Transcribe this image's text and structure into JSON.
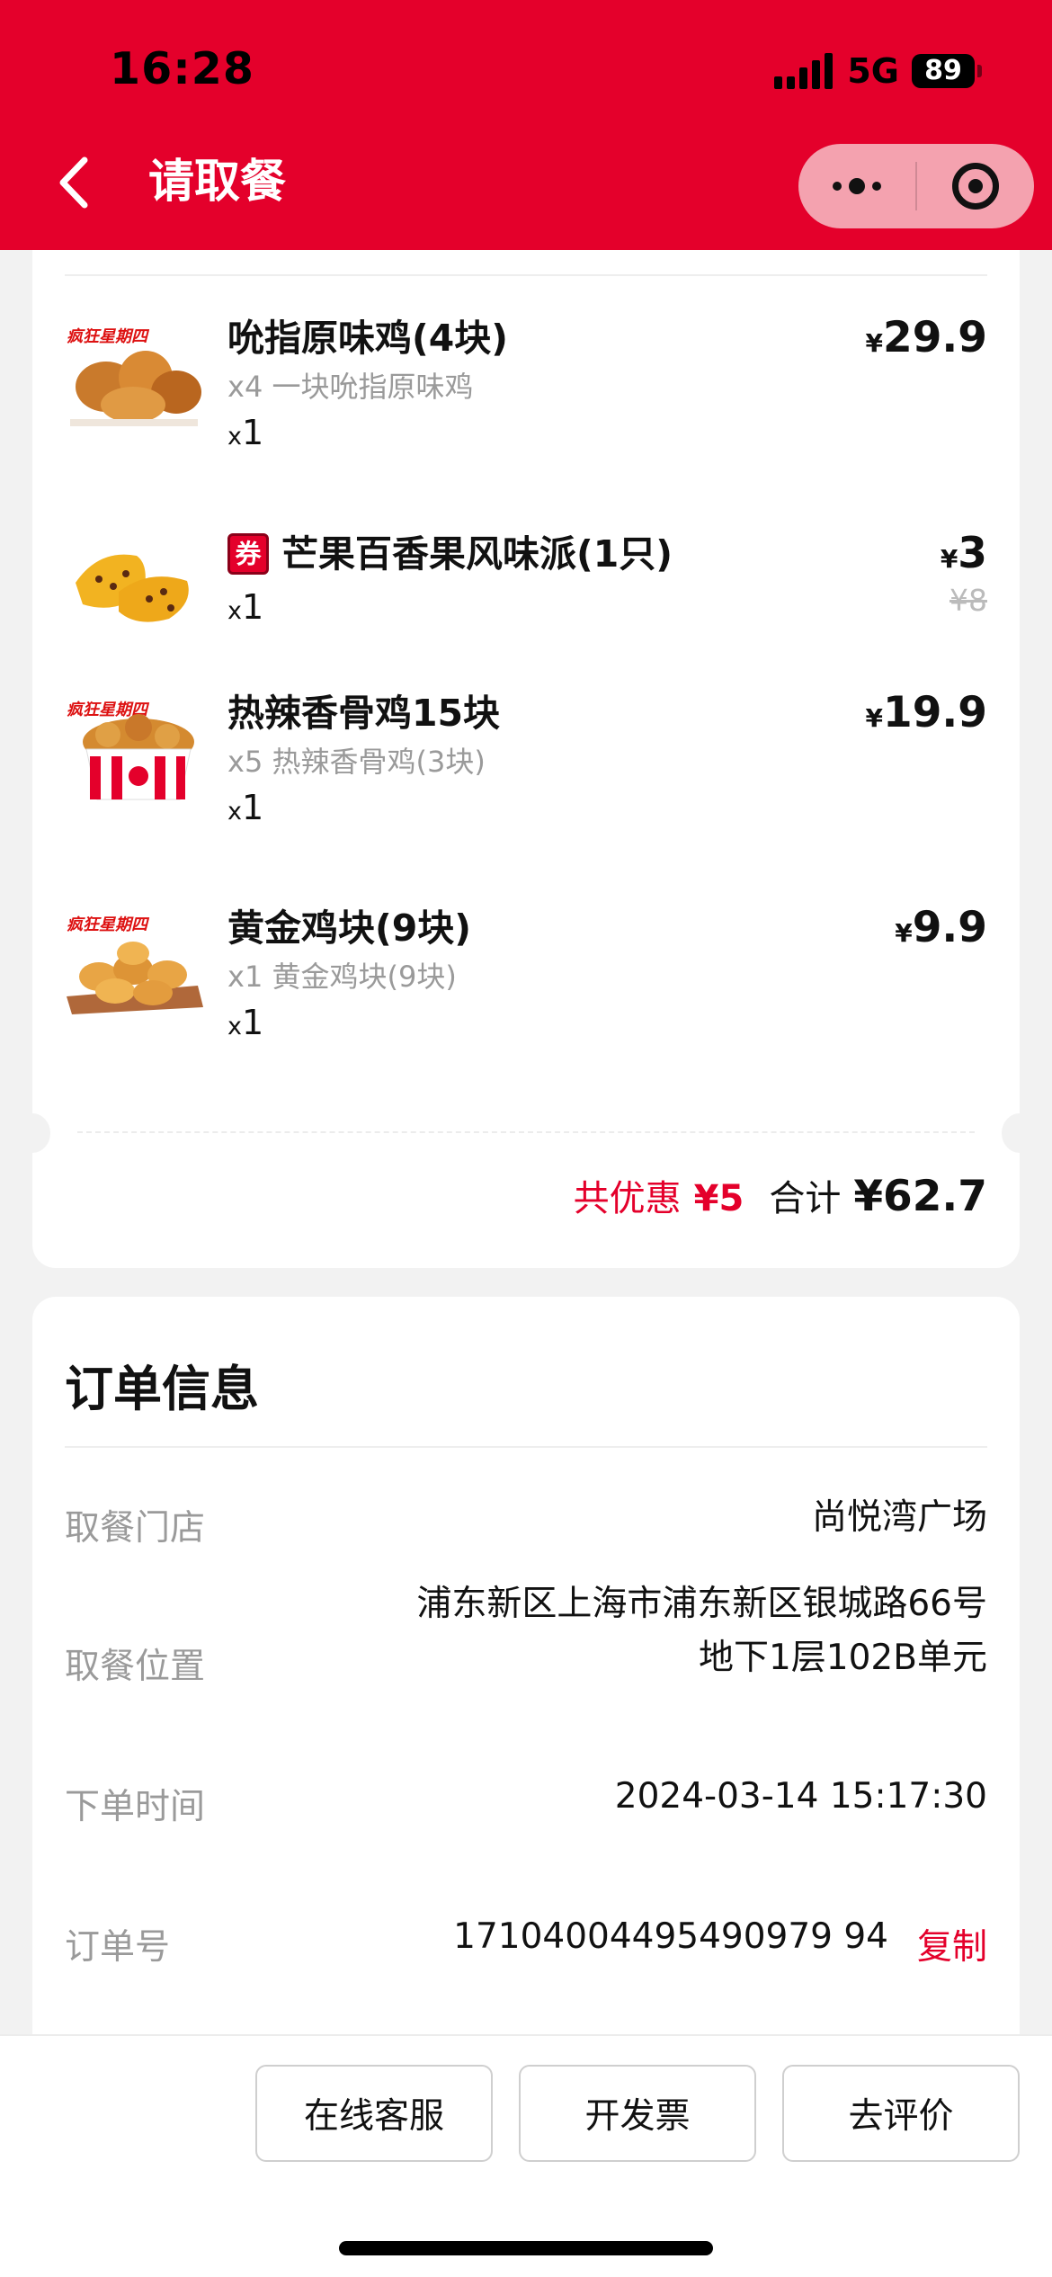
{
  "status_bar": {
    "time": "16:28",
    "network": "5G",
    "battery": "89"
  },
  "header": {
    "title": "请取餐",
    "background_color": "#e4002b"
  },
  "items": [
    {
      "name": "吮指原味鸡(4块)",
      "sub": "x4 一块吮指原味鸡",
      "qty_x": "x",
      "qty_n": "1",
      "currency": "¥",
      "price": "29.9",
      "thumb_icon": "fried-chicken-icon",
      "coupon": false
    },
    {
      "name": "芒果百香果风味派(1只)",
      "qty_x": "x",
      "qty_n": "1",
      "currency": "¥",
      "price": "3",
      "original_price": "¥8",
      "coupon": true,
      "coupon_label": "券",
      "thumb_icon": "mango-pie-icon"
    },
    {
      "name": "热辣香骨鸡15块",
      "sub": "x5 热辣香骨鸡(3块)",
      "qty_x": "x",
      "qty_n": "1",
      "currency": "¥",
      "price": "19.9",
      "thumb_icon": "chicken-bucket-icon",
      "coupon": false
    },
    {
      "name": "黄金鸡块(9块)",
      "sub": "x1 黄金鸡块(9块)",
      "qty_x": "x",
      "qty_n": "1",
      "currency": "¥",
      "price": "9.9",
      "thumb_icon": "chicken-nuggets-icon",
      "coupon": false
    }
  ],
  "totals": {
    "discount_label": "共优惠",
    "discount_value": "¥5",
    "total_label": "合计",
    "total_value": "¥62.7"
  },
  "order_info": {
    "title": "订单信息",
    "store_label": "取餐门店",
    "store_value": "尚悦湾广场",
    "location_label": "取餐位置",
    "location_line1": "浦东新区上海市浦东新区银城路66号",
    "location_line2": "地下1层102B单元",
    "time_label": "下单时间",
    "time_value": "2024-03-14 15:17:30",
    "order_no_label": "订单号",
    "order_no_value": "17104004495490979 94",
    "copy_label": "复制"
  },
  "bottom_bar": {
    "service": "在线客服",
    "invoice": "开发票",
    "review": "去评价"
  }
}
